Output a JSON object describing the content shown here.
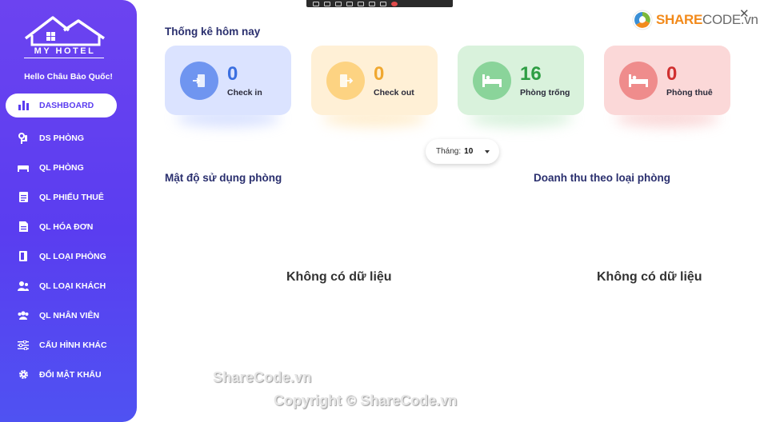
{
  "app": {
    "logo_text": "MY HOTEL",
    "greeting": "Hello Châu Bảo Quốc!"
  },
  "sidebar": {
    "items": [
      {
        "label": "DASHBOARD",
        "icon": "bar-chart-icon"
      },
      {
        "label": "DS PHÒNG",
        "icon": "key-icon"
      },
      {
        "label": "QL PHÒNG",
        "icon": "bed-icon"
      },
      {
        "label": "QL PHIẾU THUÊ",
        "icon": "document-icon"
      },
      {
        "label": "QL HÓA ĐƠN",
        "icon": "invoice-icon"
      },
      {
        "label": "QL LOẠI PHÒNG",
        "icon": "door-icon"
      },
      {
        "label": "QL LOẠI KHÁCH",
        "icon": "users-icon"
      },
      {
        "label": "QL NHÂN VIÊN",
        "icon": "staff-icon"
      },
      {
        "label": "CẤU HÌNH KHÁC",
        "icon": "sliders-icon"
      },
      {
        "label": "ĐỔI MẬT KHẨU",
        "icon": "gear-icon"
      }
    ]
  },
  "main": {
    "stats_title": "Thống kê hôm nay",
    "cards": [
      {
        "value": "0",
        "label": "Check in",
        "icon": "checkin-icon",
        "color": "#3b6fe0",
        "bg": "#dbe3ff",
        "circle": "#6f95f0"
      },
      {
        "value": "0",
        "label": "Check out",
        "icon": "checkout-icon",
        "color": "#f0a830",
        "bg": "#fff0d6",
        "circle": "#fdd382"
      },
      {
        "value": "16",
        "label": "Phòng trống",
        "icon": "bed-icon",
        "color": "#2e9e44",
        "bg": "#d9f2dc",
        "circle": "#8ad49a"
      },
      {
        "value": "0",
        "label": "Phòng thuê",
        "icon": "bed-icon",
        "color": "#d03030",
        "bg": "#fbd8d8",
        "circle": "#ef8c8c"
      }
    ],
    "month_label": "Tháng:",
    "month_value": "10",
    "chart_left_title": "Mật độ sử dụng phòng",
    "chart_right_title": "Doanh thu theo loại phòng",
    "no_data_left": "Không có dữ liệu",
    "no_data_right": "Không có dữ liệu"
  },
  "watermark": {
    "line1": "ShareCode.vn",
    "line2": "Copyright © ShareCode.vn"
  },
  "brand": {
    "share": "SHARE",
    "code": "CODE.vn",
    "close": "✕"
  }
}
